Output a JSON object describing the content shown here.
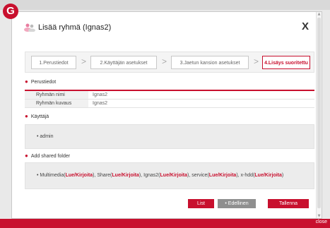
{
  "badge": "G",
  "dialog": {
    "title": "Lisää ryhmä   (Ignas2)",
    "close": "X"
  },
  "steps": [
    {
      "label": "1.Perustiedot"
    },
    {
      "label": "2.Käyttäjän asetukset"
    },
    {
      "label": "3.Jaetun kansion asetukset"
    },
    {
      "label": "4.Lisäys suoritettu"
    }
  ],
  "sections": {
    "basic": "Perustiedot",
    "user": "Käyttäjä",
    "shared": "Add shared folder"
  },
  "basic_info": {
    "name_label": "Ryhmän nimi",
    "name_value": "Ignas2",
    "desc_label": "Ryhmän kuvaus",
    "desc_value": "Ignas2"
  },
  "user_box": {
    "bullet": "•",
    "user": "admin"
  },
  "shared_box": {
    "bullet": "•",
    "folders": [
      {
        "name": "Multimedia",
        "perm": "Lue/Kirjoita"
      },
      {
        "name": "Share",
        "perm": "Lue/Kirjoita"
      },
      {
        "name": "Ignas2",
        "perm": "Lue/Kirjoita"
      },
      {
        "name": "service",
        "perm": "Lue/Kirjoita"
      },
      {
        "name": "x-hdd",
        "perm": "Lue/Kirjoita"
      }
    ]
  },
  "buttons": {
    "list": "List",
    "previous": "• Edellinen",
    "save": "Tallenna"
  },
  "footer": {
    "close_label": "close"
  }
}
